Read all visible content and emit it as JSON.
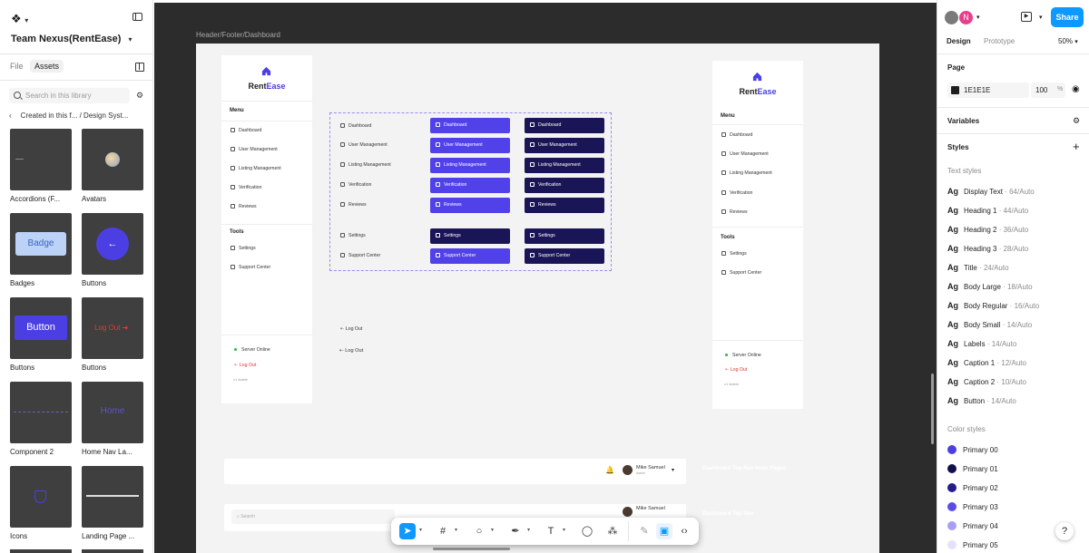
{
  "left_panel": {
    "team_name": "Team Nexus(RentEase)",
    "tabs": [
      "File",
      "Assets"
    ],
    "search_placeholder": "Search in this library",
    "breadcrumb": "Created in this f...  /  Design Syst...",
    "assets": [
      {
        "label": "Accordions (F..."
      },
      {
        "label": "Avatars"
      },
      {
        "label": "Badges",
        "preview_text": "Badge"
      },
      {
        "label": "Buttons",
        "preview_text": "←"
      },
      {
        "label": "Buttons",
        "preview_text": "Button"
      },
      {
        "label": "Buttons",
        "preview_text": "Log Out"
      },
      {
        "label": "Component 2"
      },
      {
        "label": "Home Nav La...",
        "preview_text": "Home"
      },
      {
        "label": "Icons"
      },
      {
        "label": "Landing Page ..."
      }
    ]
  },
  "canvas": {
    "frame_label": "Header/Footer/Dashboard",
    "brand": {
      "rent": "Rent",
      "ease": "Ease"
    },
    "menu_title": "Menu",
    "tools_title": "Tools",
    "menu_items": [
      "Dashboard",
      "User Management",
      "Listing Management",
      "Verification",
      "Reviews"
    ],
    "tool_items": [
      "Settings",
      "Support Center"
    ],
    "server_status": "Server Online",
    "logout": "Log Out",
    "version": "v1 stable",
    "nav_inner_label": "Dashboard Top Nav Inner Pages",
    "nav_label": "Dashboard Top Nav",
    "user_name": "Mike Samuel",
    "user_role": "Admin",
    "search_placeholder": "Search"
  },
  "right_panel": {
    "share_label": "Share",
    "avatar_letter": "N",
    "tabs": [
      "Design",
      "Prototype"
    ],
    "zoom": "50%",
    "page_title": "Page",
    "page_color": "1E1E1E",
    "page_opacity": "100",
    "percent": "%",
    "variables_title": "Variables",
    "styles_title": "Styles",
    "text_styles_title": "Text styles",
    "text_styles": [
      {
        "name": "Display Text",
        "meta": "· 64/Auto"
      },
      {
        "name": "Heading 1",
        "meta": "· 44/Auto"
      },
      {
        "name": "Heading 2",
        "meta": "· 36/Auto"
      },
      {
        "name": "Heading 3",
        "meta": "· 28/Auto"
      },
      {
        "name": "Title",
        "meta": "· 24/Auto"
      },
      {
        "name": "Body Large",
        "meta": "· 18/Auto"
      },
      {
        "name": "Body Regular",
        "meta": "· 16/Auto"
      },
      {
        "name": "Body Small",
        "meta": "· 14/Auto"
      },
      {
        "name": "Labels",
        "meta": "· 14/Auto"
      },
      {
        "name": "Caption 1",
        "meta": "· 12/Auto"
      },
      {
        "name": "Caption 2",
        "meta": "· 10/Auto"
      },
      {
        "name": "Button",
        "meta": "· 14/Auto"
      }
    ],
    "color_styles_title": "Color styles",
    "color_styles": [
      {
        "name": "Primary 00",
        "color": "#4b3fe3"
      },
      {
        "name": "Primary 01",
        "color": "#14104f"
      },
      {
        "name": "Primary 02",
        "color": "#231c8a"
      },
      {
        "name": "Primary 03",
        "color": "#5a4bea"
      },
      {
        "name": "Primary 04",
        "color": "#a79ff5"
      },
      {
        "name": "Primary 05",
        "color": "#e4e1fc"
      }
    ],
    "help": "?"
  }
}
